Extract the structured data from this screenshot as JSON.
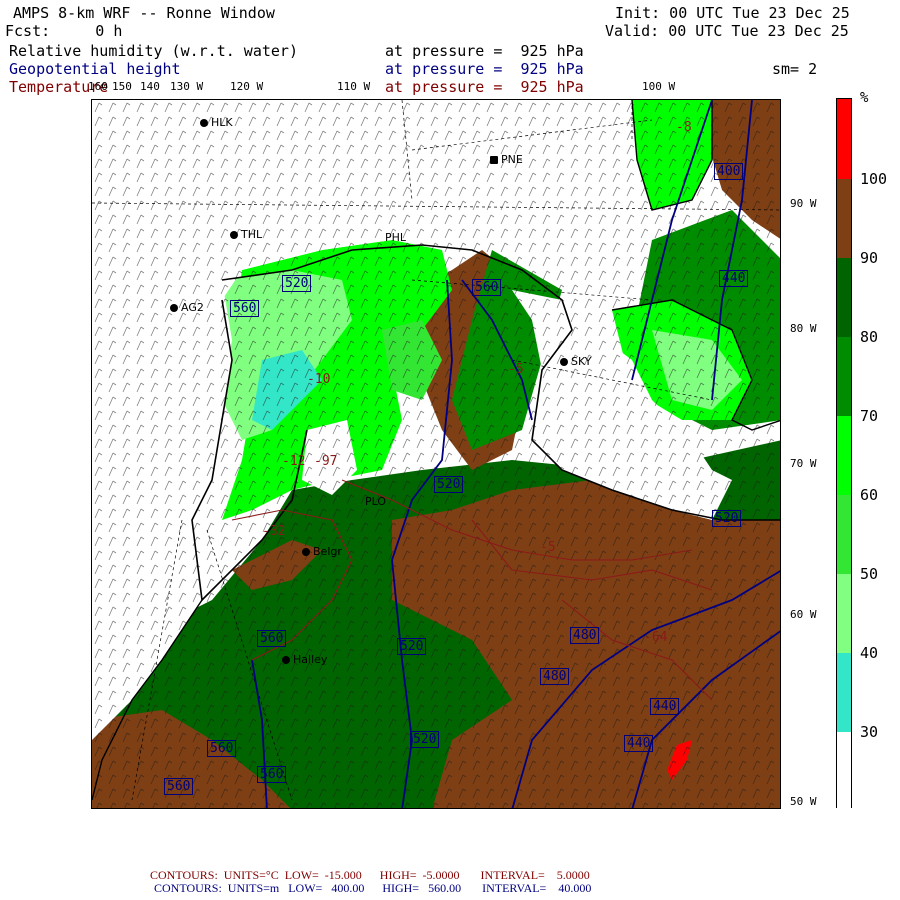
{
  "header": {
    "title": "AMPS 8-km WRF -- Ronne Window",
    "fcst": "Fcst:     0 h",
    "init": "Init: 00 UTC Tue 23 Dec 25",
    "valid": "Valid: 00 UTC Tue 23 Dec 25",
    "field1": "Relative humidity (w.r.t. water)",
    "field2": "Geopotential height",
    "field3": "Temperature",
    "pressure_label": "at pressure =  925 hPa",
    "sm": "sm= 2"
  },
  "longitudes": [
    "160",
    "150",
    "140",
    "130 W",
    "120 W",
    "110 W",
    "100 W"
  ],
  "latitudes": [
    "90 W",
    "80 W",
    "70 W",
    "60 W",
    "50 W"
  ],
  "stations": [
    "HLK",
    "PNE",
    "PHL",
    "THL",
    "AG2",
    "SKY",
    "PLO",
    "Belgr",
    "Halley"
  ],
  "height_labels": [
    "520",
    "560",
    "560",
    "520",
    "520",
    "480",
    "480",
    "520",
    "440",
    "440",
    "440",
    "400",
    "520",
    "560",
    "560",
    "560",
    "560"
  ],
  "temp_labels": [
    "-10",
    "-12",
    "-97",
    "-5",
    "-32",
    "-5",
    "-64",
    "-8"
  ],
  "colorbar": {
    "unit": "%",
    "ticks": [
      "100",
      "90",
      "80",
      "70",
      "60",
      "50",
      "40",
      "30"
    ],
    "colors": [
      "#ff0000",
      "#7f3f14",
      "#006400",
      "#008c00",
      "#00ff00",
      "#33e633",
      "#80ff80",
      "#33e6c8",
      "#ffffff"
    ]
  },
  "footer": {
    "temp": "CONTOURS:  UNITS=°C  LOW=  -15.000      HIGH=  -5.0000       INTERVAL=    5.0000",
    "height": "CONTOURS:  UNITS=m   LOW=   400.00      HIGH=   560.00       INTERVAL=    40.000"
  }
}
